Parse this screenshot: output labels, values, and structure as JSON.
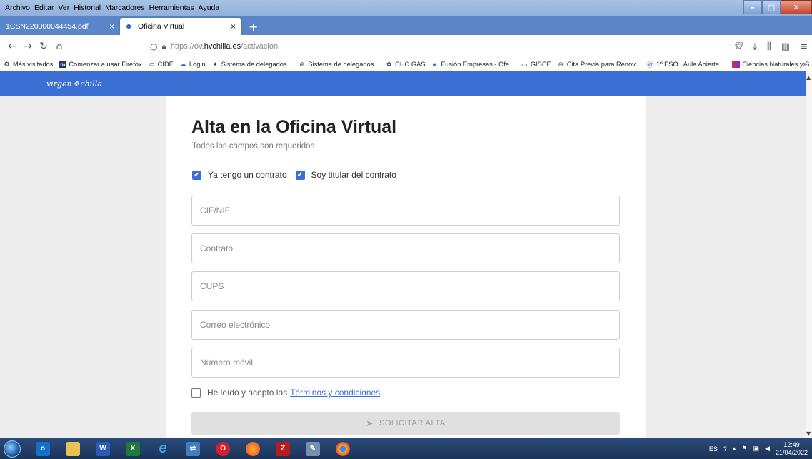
{
  "menu": {
    "items": [
      "Archivo",
      "Editar",
      "Ver",
      "Historial",
      "Marcadores",
      "Herramientas",
      "Ayuda"
    ]
  },
  "tabs": [
    {
      "label": "1CSN220300044454.pdf",
      "active": false
    },
    {
      "label": "Oficina Virtual",
      "active": true
    }
  ],
  "nav": {
    "url_prefix": "https://ov.",
    "url_domain": "hvchilla.es",
    "url_path": "/activacion"
  },
  "bookmarks": [
    {
      "label": "Más visitados",
      "icon": "gear-icon"
    },
    {
      "label": "Comenzar a usar Firefox",
      "icon": "m-icon"
    },
    {
      "label": "CIDE",
      "icon": "cide-icon"
    },
    {
      "label": "Login",
      "icon": "cloud-icon"
    },
    {
      "label": "Sistema de delegados...",
      "icon": "bolt-icon"
    },
    {
      "label": "Sistema de delegados...",
      "icon": "globe-icon"
    },
    {
      "label": "CHC GAS",
      "icon": "flower-icon"
    },
    {
      "label": "Fusión Empresas - Ofe...",
      "icon": "circle-icon"
    },
    {
      "label": "GISCE",
      "icon": "folder-icon"
    },
    {
      "label": "Cita Previa para Renov...",
      "icon": "globe-icon"
    },
    {
      "label": "1º ESO | Aula Abierta ...",
      "icon": "wordpress-icon"
    },
    {
      "label": "Ciencias Naturales y S...",
      "icon": "bookmark-icon"
    }
  ],
  "site": {
    "logo_left": "virgen",
    "logo_right": "chilla"
  },
  "form": {
    "title": "Alta en la Oficina Virtual",
    "subtitle": "Todos los campos son requeridos",
    "check_contract": "Ya tengo un contrato",
    "check_titular": "Soy titular del contrato",
    "fields": [
      {
        "placeholder": "CIF/NIF"
      },
      {
        "placeholder": "Contrato"
      },
      {
        "placeholder": "CUPS"
      },
      {
        "placeholder": "Correo electrónico"
      },
      {
        "placeholder": "Número móvil"
      }
    ],
    "terms_text": "He leído y acepto los",
    "terms_link": "Términos y condiciones",
    "submit_label": "SOLICITAR ALTA"
  },
  "tray": {
    "lang": "ES",
    "time": "12:49",
    "date": "21/04/2022"
  },
  "colors": {
    "accent": "#3b6fd4",
    "tab_strip": "#5a86c9"
  }
}
